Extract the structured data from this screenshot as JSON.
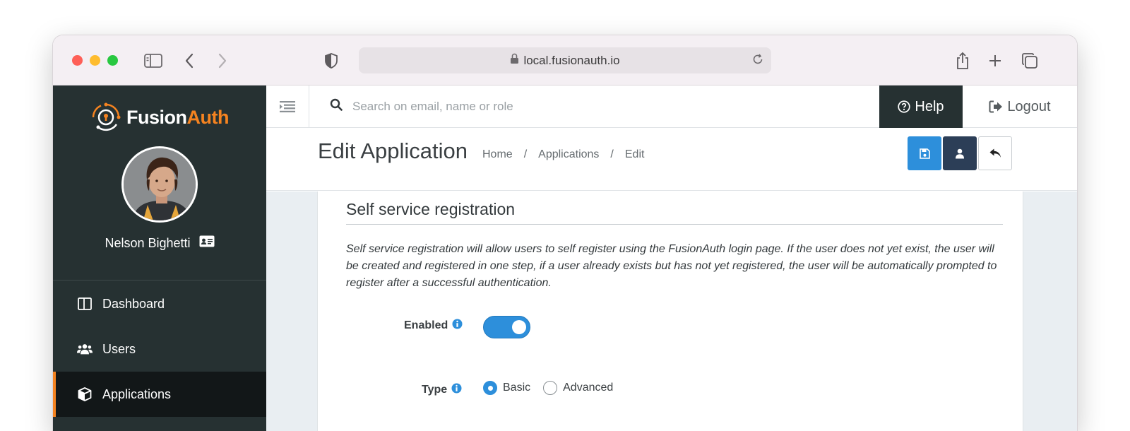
{
  "browser": {
    "url": "local.fusionauth.io"
  },
  "sidebar": {
    "logo": {
      "part1": "Fusion",
      "part2": "Auth"
    },
    "user_name": "Nelson Bighetti",
    "items": [
      {
        "label": "Dashboard",
        "icon": "dashboard-icon"
      },
      {
        "label": "Users",
        "icon": "users-icon"
      },
      {
        "label": "Applications",
        "icon": "applications-icon",
        "active": true
      }
    ]
  },
  "appbar": {
    "search_placeholder": "Search on email, name or role",
    "help_label": "Help",
    "logout_label": "Logout"
  },
  "page": {
    "title": "Edit Application",
    "breadcrumb": [
      "Home",
      "Applications",
      "Edit"
    ],
    "breadcrumb_sep": "/"
  },
  "section": {
    "title": "Self service registration",
    "description": "Self service registration will allow users to self register using the FusionAuth login page. If the user does not yet exist, the user will be created and registered in one step, if a user already exists but has not yet registered, the user will be automatically prompted to register after a successful authentication.",
    "enabled_label": "Enabled",
    "enabled": true,
    "type_label": "Type",
    "type_options": [
      "Basic",
      "Advanced"
    ],
    "type_selected": "Basic"
  },
  "colors": {
    "sidebar_bg": "#263132",
    "accent_orange": "#f58320",
    "primary_blue": "#2d8fdb",
    "dark_navy": "#2c3e57"
  }
}
